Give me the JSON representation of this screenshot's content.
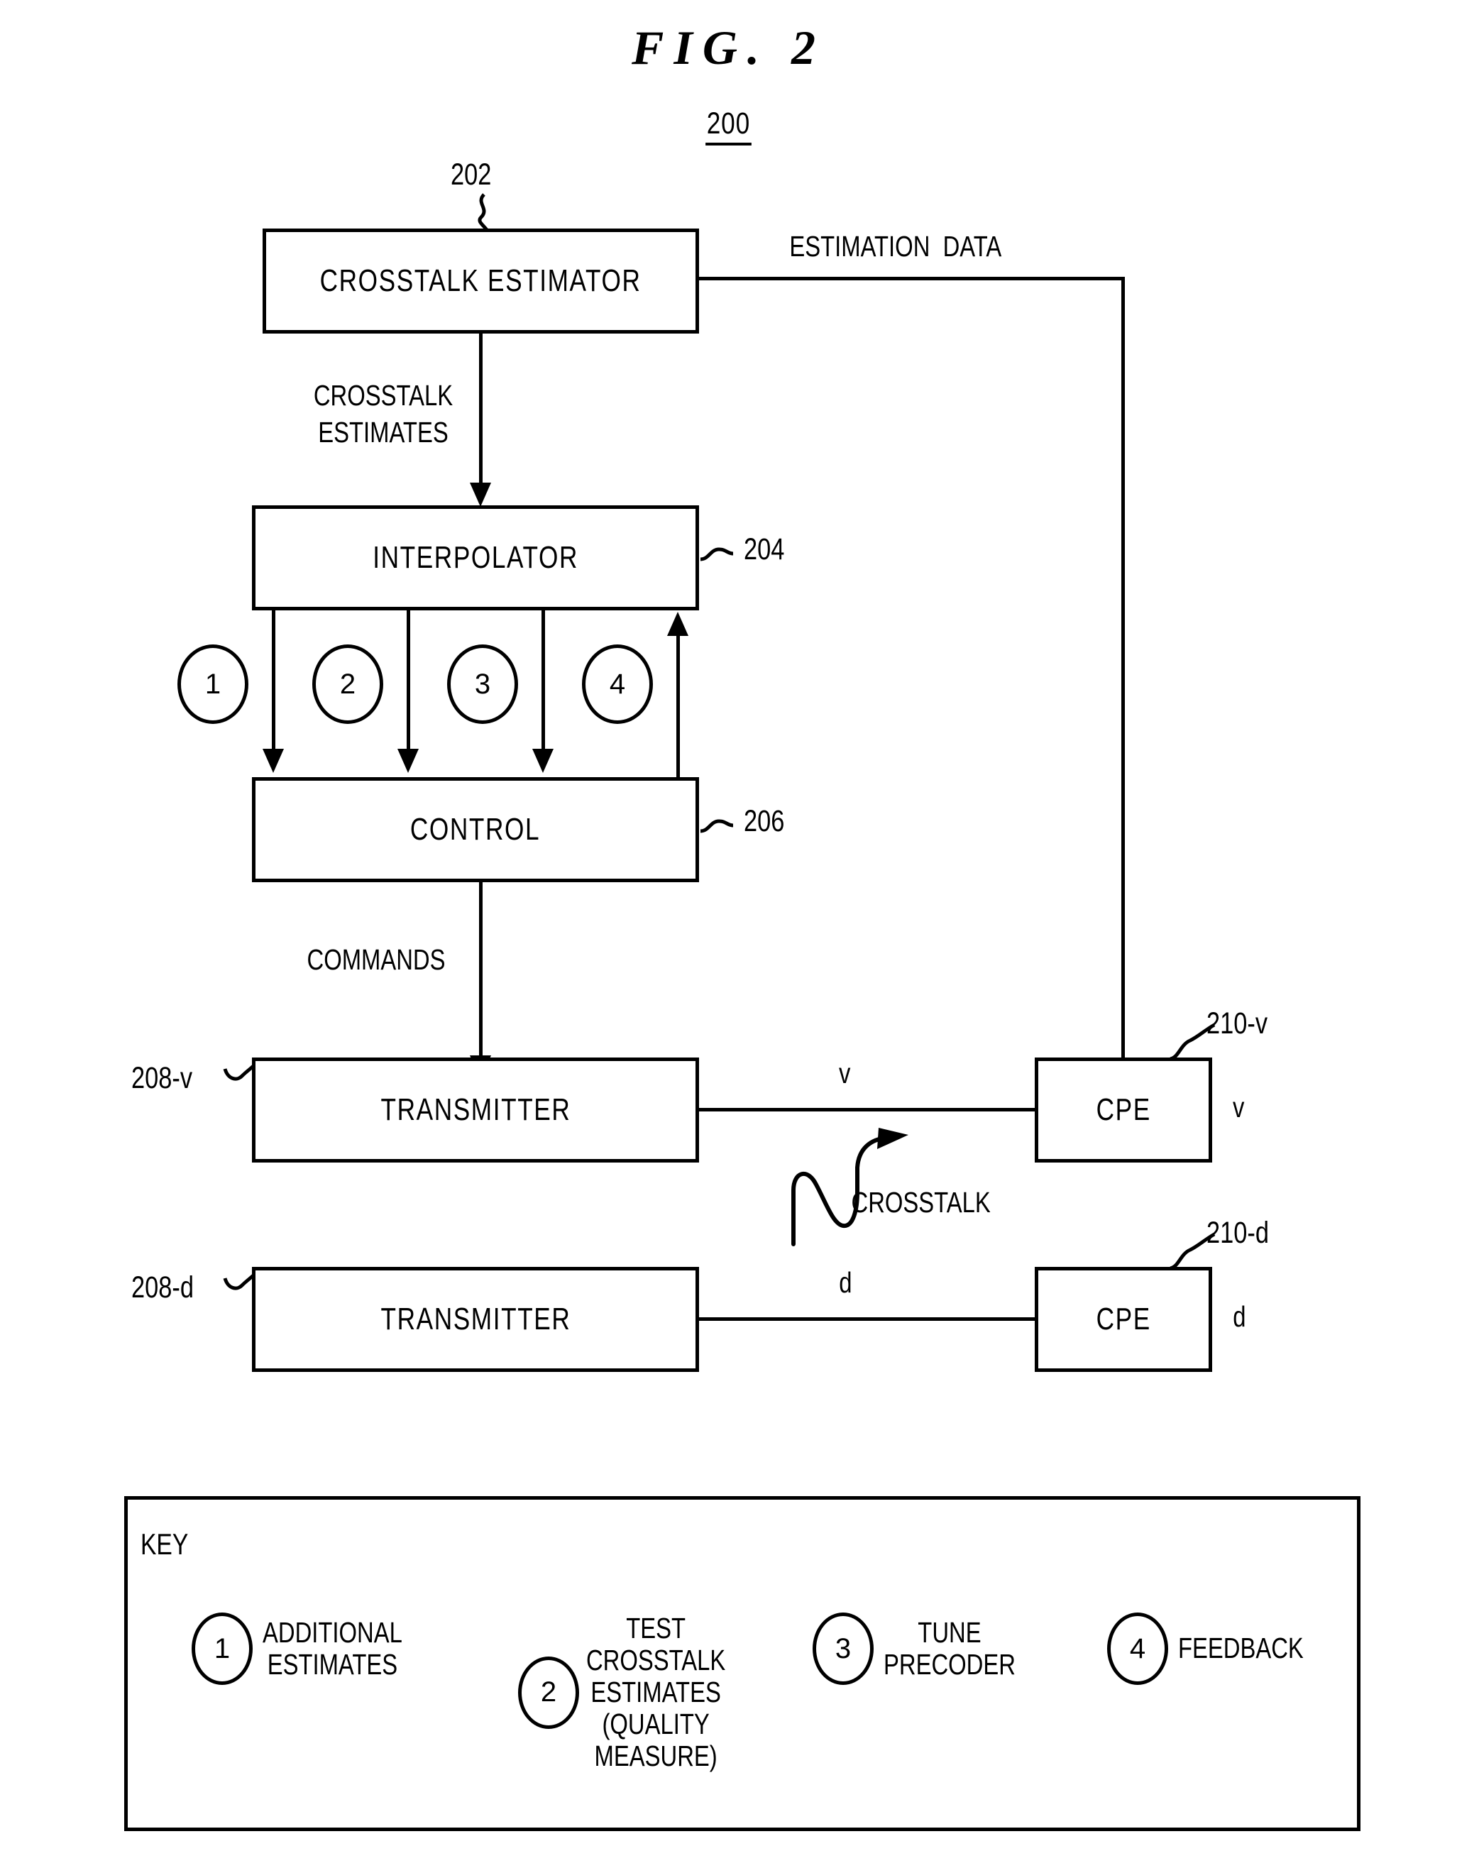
{
  "figure": {
    "title": "FIG. 2",
    "number": "200"
  },
  "blocks": {
    "crosstalk_estimator": {
      "label": "CROSSTALK  ESTIMATOR",
      "ref": "202"
    },
    "interpolator": {
      "label": "INTERPOLATOR",
      "ref": "204"
    },
    "control": {
      "label": "CONTROL",
      "ref": "206"
    },
    "transmitter_v": {
      "label": "TRANSMITTER",
      "ref": "208-v"
    },
    "transmitter_d": {
      "label": "TRANSMITTER",
      "ref": "208-d"
    },
    "cpe_v": {
      "label": "CPE",
      "ref": "210-v",
      "line_label": "v",
      "side_label": "v"
    },
    "cpe_d": {
      "label": "CPE",
      "ref": "210-d",
      "line_label": "d",
      "side_label": "d"
    }
  },
  "flow_labels": {
    "estimation_data": "ESTIMATION  DATA",
    "crosstalk_estimates_l1": "CROSSTALK",
    "crosstalk_estimates_l2": "ESTIMATES",
    "commands": "COMMANDS",
    "crosstalk": "CROSSTALK"
  },
  "markers": {
    "m1": "1",
    "m2": "2",
    "m3": "3",
    "m4": "4"
  },
  "key": {
    "title": "KEY",
    "entries": [
      {
        "num": "1",
        "text": "ADDITIONAL\nESTIMATES"
      },
      {
        "num": "2",
        "text": "TEST\nCROSSTALK\nESTIMATES\n(QUALITY\nMEASURE)"
      },
      {
        "num": "3",
        "text": "TUNE\nPRECODER"
      },
      {
        "num": "4",
        "text": "FEEDBACK"
      }
    ]
  },
  "colors": {
    "ink": "#000000",
    "paper": "#ffffff"
  }
}
